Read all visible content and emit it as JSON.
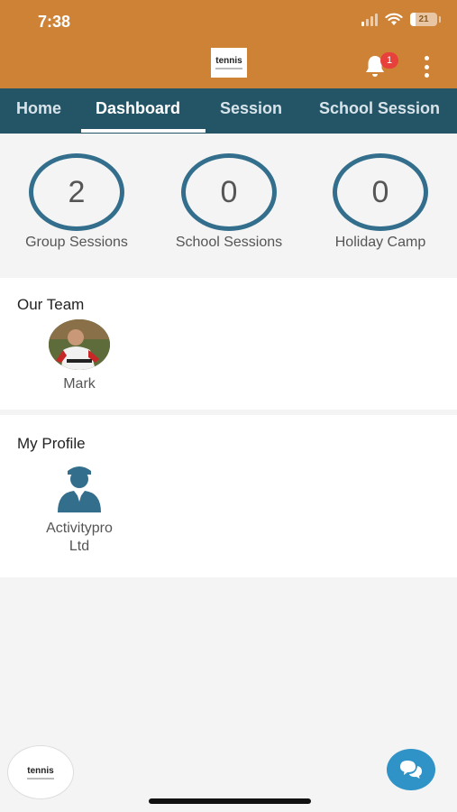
{
  "status_bar": {
    "time": "7:38",
    "battery": "21",
    "battery_level": 0.21
  },
  "header": {
    "logo_text": "tennis",
    "notification_count": "1",
    "icons": [
      "bell-icon",
      "kebab-menu-icon"
    ]
  },
  "tabs": [
    {
      "label": "Home",
      "active": false
    },
    {
      "label": "Dashboard",
      "active": true
    },
    {
      "label": "Session",
      "active": false
    },
    {
      "label": "School Session",
      "active": false
    }
  ],
  "stats": [
    {
      "value": "2",
      "label": "Group Sessions"
    },
    {
      "value": "0",
      "label": "School Sessions"
    },
    {
      "value": "0",
      "label": "Holiday Camp"
    }
  ],
  "team": {
    "title": "Our Team",
    "members": [
      {
        "name": "Mark"
      }
    ]
  },
  "profile": {
    "title": "My Profile",
    "name_line1": "Activitypro",
    "name_line2": "Ltd"
  },
  "footer": {
    "logo_text": "tennis",
    "chat_icon": "chat-bubbles-icon"
  },
  "colors": {
    "header": "#cd8236",
    "tabbar": "#245567",
    "ring": "#336f8c",
    "chat": "#2f93c7",
    "badge": "#e8403a"
  }
}
